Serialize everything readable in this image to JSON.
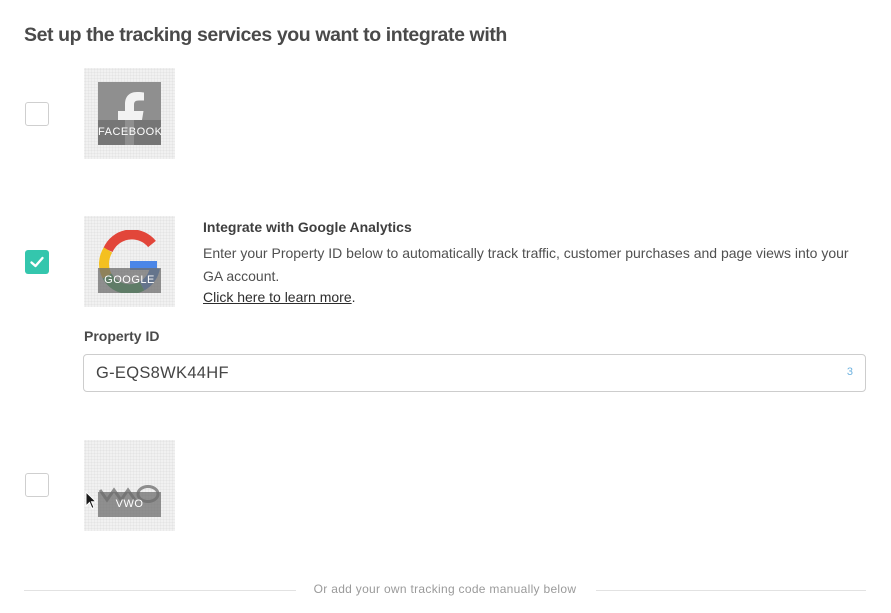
{
  "page": {
    "title": "Set up the tracking services you want to integrate with"
  },
  "services": [
    {
      "id": "facebook",
      "label": "FACEBOOK",
      "checked": false,
      "icon": "facebook-logo"
    },
    {
      "id": "google",
      "label": "GOOGLE",
      "checked": true,
      "icon": "google-logo"
    },
    {
      "id": "vwo",
      "label": "VWO",
      "checked": false,
      "icon": "vwo-logo"
    }
  ],
  "google_analytics": {
    "heading": "Integrate with Google Analytics",
    "description": "Enter your Property ID below to automatically track traffic, customer purchases and page views into your GA account.",
    "link_text": "Click here to learn more",
    "link_suffix": ".",
    "field_label": "Property ID",
    "property_id_value": "G-EQS8WK44HF",
    "char_counter": "3"
  },
  "footer": {
    "divider_text": "Or add your own tracking code manually below"
  },
  "colors": {
    "accent": "#34c6ad",
    "counter": "#6fb3e0"
  }
}
